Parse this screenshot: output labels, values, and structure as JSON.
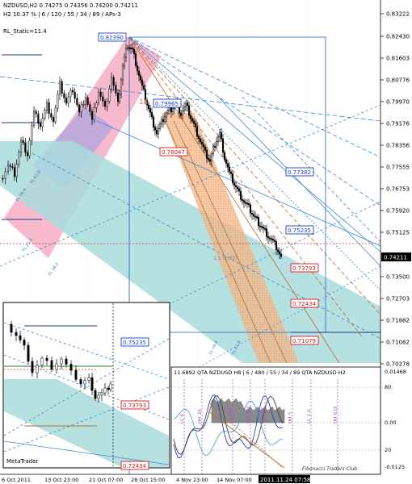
{
  "header": {
    "line1": "NZDUSD,H2  0.74275  0.74356  0.74200  0.74211",
    "line2": "H2  10.37 %  |  6 / 120 / 55 / 34 / 89 / APs-3",
    "line3": "RL_Static=11.4"
  },
  "price_axis": {
    "ticks": [
      "0.83222",
      "0.82430",
      "0.81603",
      "0.80776",
      "0.79970",
      "0.79176",
      "0.78356",
      "0.77555",
      "0.76753",
      "0.75920",
      "0.75125",
      "0.74211",
      "0.73500",
      "0.72703",
      "0.71882",
      "0.71082",
      "0.70278"
    ],
    "current_price": "0.74211"
  },
  "time_axis": {
    "labels": [
      "6 Oct 2011",
      "13 Oct 23:00",
      "21 Oct 07:00",
      "28 Oct 15:00",
      "4 Nov 23:00",
      "14 Nov 07:00"
    ],
    "cursor_time": "2011.11.24 07:58"
  },
  "level_boxes": [
    {
      "text": "0.82390",
      "color": "#1a3dd8"
    },
    {
      "text": "0.79965",
      "color": "#1a3dd8"
    },
    {
      "text": "0.78047",
      "color": "#d81a1a"
    },
    {
      "text": "0.77382",
      "color": "#1a3dd8"
    },
    {
      "text": "0.75235",
      "color": "#1a3dd8"
    },
    {
      "text": "0.73793",
      "color": "#d81a1a"
    },
    {
      "text": "0.72434",
      "color": "#d81a1a"
    },
    {
      "text": "0.71079",
      "color": "#d81a1a"
    }
  ],
  "chart_labels": {
    "fib_label": "1.1 (1.07)",
    "fib_14": "14"
  },
  "inset": {
    "levels": [
      {
        "text": "0.75235",
        "color": "#1a3dd8"
      },
      {
        "text": "0.73793",
        "color": "#d81a1a"
      },
      {
        "text": "0.72434",
        "color": "#d81a1a"
      }
    ],
    "watermark": "MetaTrader"
  },
  "oscillator": {
    "header": "11.6892  QTA  NZDUSD H8  |  6 / 480 / 55 / 34 / 89  QTA  NZDUSD H2",
    "scale": [
      "0.01468",
      "80",
      "0.00",
      "20",
      "-0.0125"
    ],
    "vlabels": [
      "LL_6",
      "HH_26",
      "LL_764",
      "HH_382",
      "LL_854",
      "HH_5",
      "LL_1.0",
      "HH_618"
    ],
    "club": "Fibonacci Traders Club"
  },
  "colors": {
    "accent_blue": "#1a3dd8",
    "accent_red": "#d81a1a",
    "pink_channel": "#f6a8c0",
    "cyan_channel": "#a8dcdc",
    "orange_fan": "#f3b888"
  }
}
